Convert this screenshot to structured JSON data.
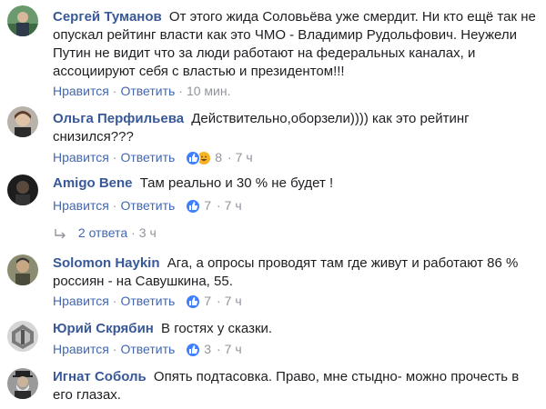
{
  "comments": [
    {
      "author": "Сергей Туманов",
      "text": "От этого жида Соловьёва уже смердит. Ни кто ещё так не опускал рейтинг власти как это ЧМО - Владимир Рудольфович. Неужели Путин не видит что за люди работают на федеральных каналах, и ассоциируют себя с властью и президентом!!!",
      "like_label": "Нравится",
      "reply_label": "Ответить",
      "time": "10 мин."
    },
    {
      "author": "Ольга Перфильева",
      "text": "Действительно,оборзели)))) как это рейтинг снизился???",
      "like_label": "Нравится",
      "reply_label": "Ответить",
      "reactions": "8",
      "time": "7 ч"
    },
    {
      "author": "Amigo Bene",
      "text": "Там реально и 30 % не будет !",
      "like_label": "Нравится",
      "reply_label": "Ответить",
      "reactions": "7",
      "time": "7 ч"
    },
    {
      "author": "Solomon Haykin",
      "text": "Ага, а опросы проводят там где живут и работают 86 % россиян - на Савушкина, 55.",
      "like_label": "Нравится",
      "reply_label": "Ответить",
      "reactions": "7",
      "time": "7 ч"
    },
    {
      "author": "Юрий Скрябин",
      "text": "В гостях у сказки.",
      "like_label": "Нравится",
      "reply_label": "Ответить",
      "reactions": "3",
      "time": "7 ч"
    },
    {
      "author": "Игнат Соболь",
      "text": "Опять подтасовка. Право, мне стыдно- можно прочесть в его глазах."
    }
  ],
  "replies_thread": {
    "label": "2 ответа",
    "time": "3 ч"
  },
  "colors": {
    "author": "#385898",
    "link": "#4267b2",
    "meta": "#90949c",
    "like_reaction": "#4080ff",
    "haha_reaction": "#f7b125"
  }
}
